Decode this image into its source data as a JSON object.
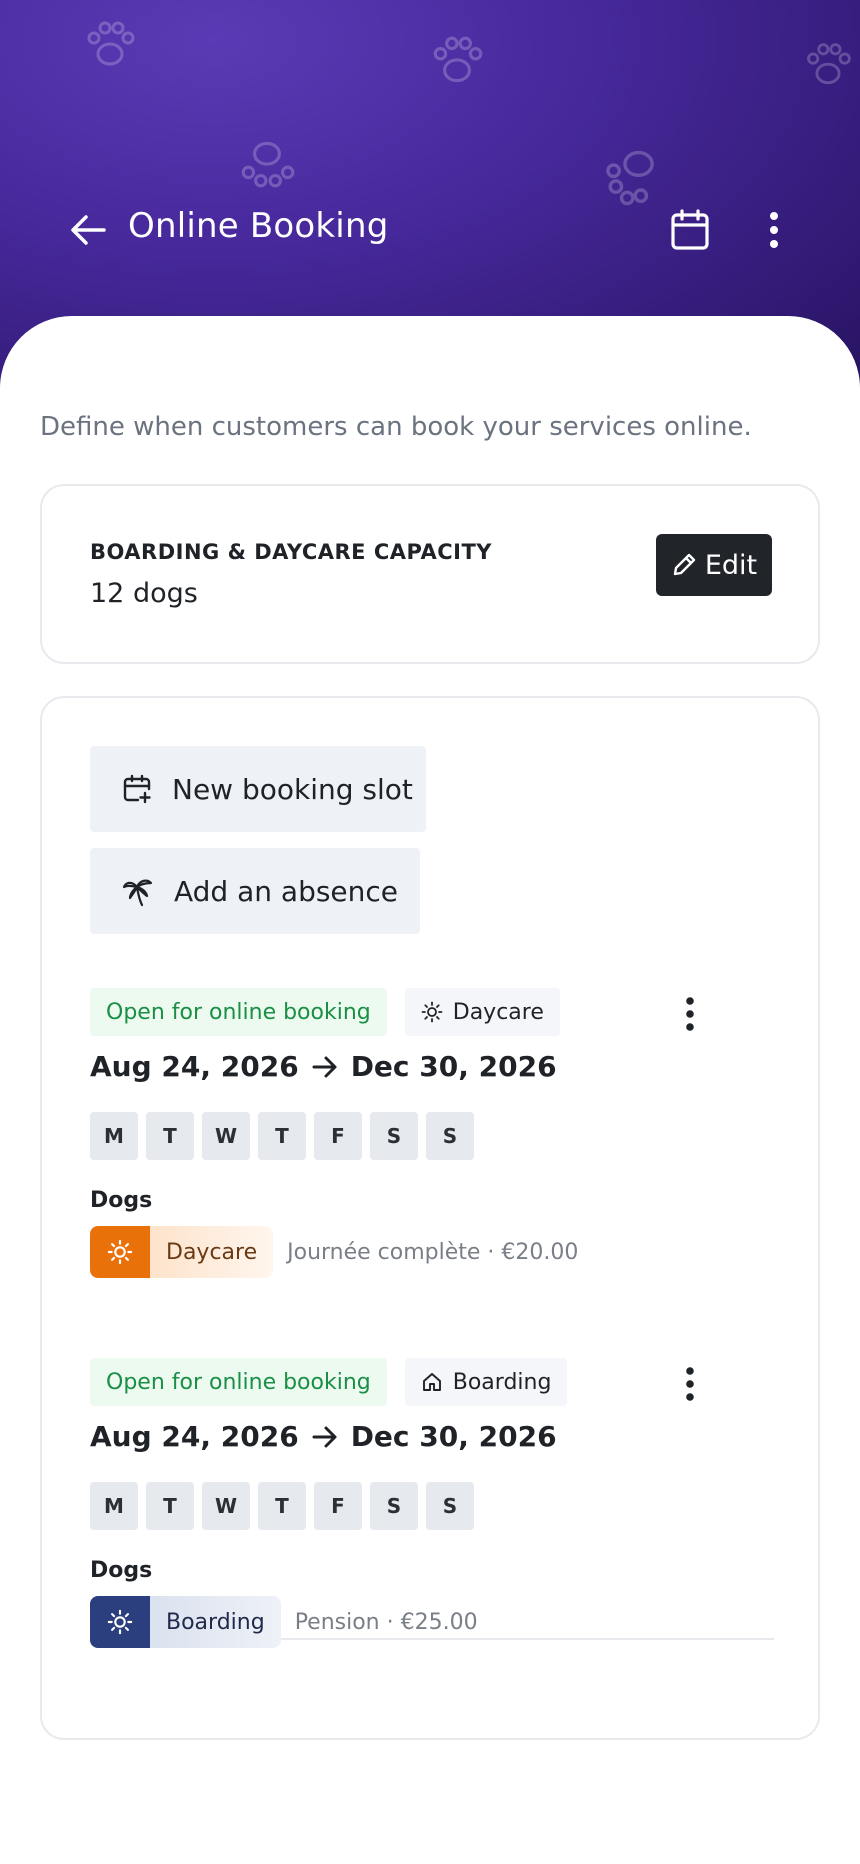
{
  "header": {
    "title": "Online Booking",
    "back_icon": "arrow-left-icon",
    "calendar_icon": "calendar-icon",
    "menu_icon": "kebab-menu-icon",
    "background_color": "#47299c"
  },
  "intro": "Define when customers can book your services online.",
  "capacity": {
    "label": "BOARDING & DAYCARE CAPACITY",
    "value": "12 dogs",
    "edit_label": "Edit"
  },
  "actions": {
    "new_slot_label": "New booking slot",
    "add_absence_label": "Add an absence"
  },
  "slots": [
    {
      "status": "Open for online booking",
      "service_tag": "Daycare",
      "service_tag_icon": "sun-icon",
      "date_from": "Aug 24, 2026",
      "date_to": "Dec 30, 2026",
      "days": [
        "M",
        "T",
        "W",
        "T",
        "F",
        "S",
        "S"
      ],
      "pet_type": "Dogs",
      "service_name": "Daycare",
      "service_color": "#e8710a",
      "service_detail": "Journée complète · €20.00"
    },
    {
      "status": "Open for online booking",
      "service_tag": "Boarding",
      "service_tag_icon": "house-icon",
      "date_from": "Aug 24, 2026",
      "date_to": "Dec 30, 2026",
      "days": [
        "M",
        "T",
        "W",
        "T",
        "F",
        "S",
        "S"
      ],
      "pet_type": "Dogs",
      "service_name": "Boarding",
      "service_color": "#2b3f7e",
      "service_detail": "Pension · €25.00"
    }
  ],
  "colors": {
    "open_tag_text": "#1a8f45",
    "open_tag_bg": "#ecfaf0",
    "primary_button": "#212529"
  }
}
